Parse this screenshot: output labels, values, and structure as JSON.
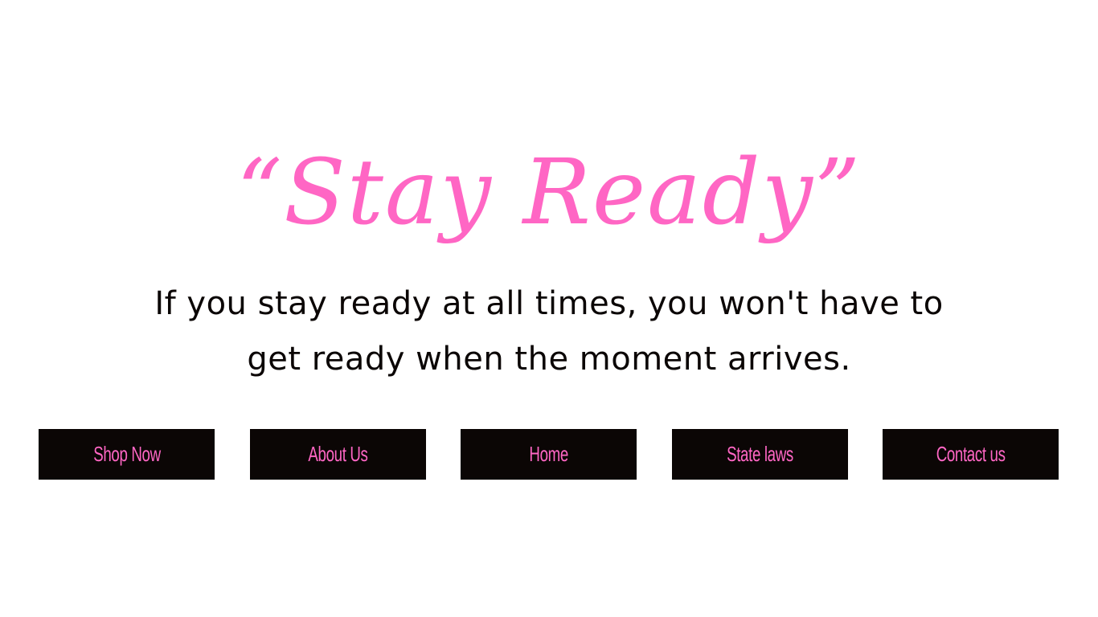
{
  "hero": {
    "title": "“Stay Ready”",
    "quote_line1": "If you stay ready at all times, you won't have to",
    "quote_line2": "get ready when the moment arrives."
  },
  "nav": {
    "buttons": [
      {
        "label": "Shop Now"
      },
      {
        "label": "About Us"
      },
      {
        "label": "Home"
      },
      {
        "label": "State laws"
      },
      {
        "label": "Contact us"
      }
    ]
  },
  "colors": {
    "accent_pink": "#ff66c4",
    "button_black": "#0b0605",
    "background": "#ffffff",
    "text": "#0b0605"
  }
}
